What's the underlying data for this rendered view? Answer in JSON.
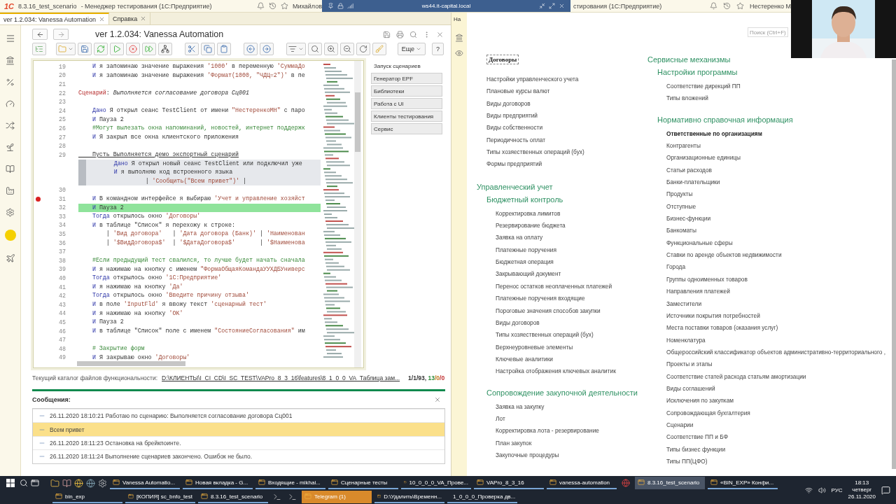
{
  "top_bar": {
    "logo": "1С",
    "app_title": "8.3.16_test_scenario",
    "subtitle": "- Менеджер тестирования (1С:Предприятие)",
    "user": "Михайлов",
    "remote_host": "ws44.it-capital.local",
    "right_title": "стирования (1С:Предприятие)",
    "right_user": "Нестеренко М"
  },
  "tabs": [
    {
      "label": "ver 1.2.034: Vanessa Automation",
      "selected": true
    },
    {
      "label": "Справка",
      "selected": false
    }
  ],
  "vanessa": {
    "title": "ver 1.2.034: Vanessa Automation",
    "more_button": "Еще",
    "help_button": "?",
    "code_lines": [
      {
        "number": "19",
        "kind": "code",
        "parts": [
          {
            "kind": "kw",
            "text": "    И"
          },
          {
            "kind": "txt",
            "text": " я запоминаю значение выражения "
          },
          {
            "kind": "str",
            "text": "'1000'"
          },
          {
            "kind": "txt",
            "text": " в переменную "
          },
          {
            "kind": "str",
            "text": "'СуммаДо"
          }
        ]
      },
      {
        "number": "20",
        "kind": "code",
        "parts": [
          {
            "kind": "kw",
            "text": "    И"
          },
          {
            "kind": "txt",
            "text": " я запоминаю значение выражения "
          },
          {
            "kind": "str",
            "text": "'Формат(1000, \"ЧДЦ=2\")'"
          },
          {
            "kind": "txt",
            "text": " в пе"
          }
        ]
      },
      {
        "number": "21",
        "kind": "code"
      },
      {
        "number": "22",
        "kind": "code",
        "parts": [
          {
            "kind": "head",
            "text": "Сценарий"
          },
          {
            "kind": "txt",
            "text": ":"
          },
          {
            "kind": "ital",
            "text": " Выполняется согласование договора Сц001"
          }
        ]
      },
      {
        "number": "23",
        "kind": "code"
      },
      {
        "number": "24",
        "kind": "code",
        "parts": [
          {
            "kind": "kw",
            "text": "    Дано"
          },
          {
            "kind": "txt",
            "text": " Я открыл сеанс TestClient от имени "
          },
          {
            "kind": "str",
            "text": "\"НестеренкоМН\""
          },
          {
            "kind": "txt",
            "text": " с паро"
          }
        ]
      },
      {
        "number": "25",
        "kind": "code",
        "parts": [
          {
            "kind": "kw",
            "text": "    И"
          },
          {
            "kind": "txt",
            "text": " Пауза 2"
          }
        ]
      },
      {
        "number": "26",
        "kind": "code",
        "parts": [
          {
            "kind": "cmt",
            "text": "    #Могут вылезать окна напоминаний, новостей, интернет поддержк"
          }
        ]
      },
      {
        "number": "27",
        "kind": "code",
        "parts": [
          {
            "kind": "kw",
            "text": "    И"
          },
          {
            "kind": "txt",
            "text": " Я закрыл все окна клиентского приложения"
          }
        ]
      },
      {
        "number": "28",
        "kind": "code"
      },
      {
        "number": "29",
        "kind": "code",
        "parts": [
          {
            "kind": "link",
            "text": "    Пусть Выполняется демо экспортный сценарий"
          }
        ]
      },
      {
        "kind": "inline",
        "parts": [
          {
            "kind": "kw",
            "text": "        Дано"
          },
          {
            "kind": "txt",
            "text": " Я открыл новый сеанс TestClient или подключил уже"
          }
        ]
      },
      {
        "kind": "inline",
        "parts": [
          {
            "kind": "kw",
            "text": "        И"
          },
          {
            "kind": "txt",
            "text": " я выполняю код встроенного языка"
          }
        ]
      },
      {
        "kind": "inline",
        "parts": [
          {
            "kind": "txt",
            "text": "                 | "
          },
          {
            "kind": "str",
            "text": "'Сообщить(\"Всем привет\")'"
          },
          {
            "kind": "txt",
            "text": " |"
          }
        ]
      },
      {
        "number": "30",
        "kind": "code"
      },
      {
        "number": "31",
        "kind": "breakpoint",
        "parts": [
          {
            "kind": "kw",
            "text": "    И"
          },
          {
            "kind": "txt",
            "text": " В командном интерфейсе я выбираю "
          },
          {
            "kind": "str",
            "text": "'Учет и управление хозяйст"
          }
        ]
      },
      {
        "number": "32",
        "kind": "current",
        "parts": [
          {
            "kind": "kw",
            "text": "    И"
          },
          {
            "kind": "txt",
            "text": " Пауза 2"
          }
        ]
      },
      {
        "number": "33",
        "kind": "code",
        "parts": [
          {
            "kind": "kw",
            "text": "    Тогда"
          },
          {
            "kind": "txt",
            "text": " открылось окно "
          },
          {
            "kind": "str",
            "text": "'Договоры'"
          }
        ]
      },
      {
        "number": "34",
        "kind": "code",
        "parts": [
          {
            "kind": "kw",
            "text": "    И"
          },
          {
            "kind": "txt",
            "text": " в таблице \"Список\" я перехожу к строке:"
          }
        ]
      },
      {
        "number": "35",
        "kind": "code",
        "parts": [
          {
            "kind": "txt",
            "text": "        | "
          },
          {
            "kind": "str",
            "text": "'Вид договора'"
          },
          {
            "kind": "txt",
            "text": "   | "
          },
          {
            "kind": "str",
            "text": "'Дата договора (Банк)'"
          },
          {
            "kind": "txt",
            "text": " | "
          },
          {
            "kind": "str",
            "text": "'Наименован"
          }
        ]
      },
      {
        "number": "36",
        "kind": "code",
        "parts": [
          {
            "kind": "txt",
            "text": "        | "
          },
          {
            "kind": "str",
            "text": "'$ВидДоговора$'"
          },
          {
            "kind": "txt",
            "text": "  | "
          },
          {
            "kind": "str",
            "text": "'$ДатаДоговора$'"
          },
          {
            "kind": "txt",
            "text": "       | "
          },
          {
            "kind": "str",
            "text": "'$Наименова"
          }
        ]
      },
      {
        "number": "37",
        "kind": "code"
      },
      {
        "number": "38",
        "kind": "code",
        "parts": [
          {
            "kind": "cmt",
            "text": "    #Если предыдущий тест свалился, то лучше будет начать сначала"
          }
        ]
      },
      {
        "number": "39",
        "kind": "code",
        "parts": [
          {
            "kind": "kw",
            "text": "    И"
          },
          {
            "kind": "txt",
            "text": " я нажимаю на кнопку с именем "
          },
          {
            "kind": "str",
            "text": "\"ФормаОбщаяКомандаУУХДБУниверс"
          }
        ]
      },
      {
        "number": "40",
        "kind": "code",
        "parts": [
          {
            "kind": "kw",
            "text": "    Тогда"
          },
          {
            "kind": "txt",
            "text": " открылось окно "
          },
          {
            "kind": "str",
            "text": "'1С:Предприятие'"
          }
        ]
      },
      {
        "number": "41",
        "kind": "code",
        "parts": [
          {
            "kind": "kw",
            "text": "    И"
          },
          {
            "kind": "txt",
            "text": " я нажимаю на кнопку "
          },
          {
            "kind": "str",
            "text": "'Да'"
          }
        ]
      },
      {
        "number": "42",
        "kind": "code",
        "parts": [
          {
            "kind": "kw",
            "text": "    Тогда"
          },
          {
            "kind": "txt",
            "text": " открылось окно "
          },
          {
            "kind": "str",
            "text": "'Введите причину отзыва'"
          }
        ]
      },
      {
        "number": "43",
        "kind": "code",
        "parts": [
          {
            "kind": "kw",
            "text": "    И"
          },
          {
            "kind": "txt",
            "text": " в поле "
          },
          {
            "kind": "str",
            "text": "'InputFld'"
          },
          {
            "kind": "txt",
            "text": " я ввожу текст "
          },
          {
            "kind": "str",
            "text": "'сценарный тест'"
          }
        ]
      },
      {
        "number": "44",
        "kind": "code",
        "parts": [
          {
            "kind": "kw",
            "text": "    И"
          },
          {
            "kind": "txt",
            "text": " я нажимаю на кнопку "
          },
          {
            "kind": "str",
            "text": "'OK'"
          }
        ]
      },
      {
        "number": "45",
        "kind": "code",
        "parts": [
          {
            "kind": "kw",
            "text": "    И"
          },
          {
            "kind": "txt",
            "text": " Пауза 2"
          }
        ]
      },
      {
        "number": "46",
        "kind": "code",
        "parts": [
          {
            "kind": "kw",
            "text": "    И"
          },
          {
            "kind": "txt",
            "text": " в таблице \"Список\" поле с именем "
          },
          {
            "kind": "str",
            "text": "\"СостояниеСогласования\""
          },
          {
            "kind": "txt",
            "text": " им"
          }
        ]
      },
      {
        "number": "47",
        "kind": "code"
      },
      {
        "number": "48",
        "kind": "code",
        "parts": [
          {
            "kind": "cmt",
            "text": "    # Закрытие форм"
          }
        ]
      },
      {
        "number": "49",
        "kind": "code",
        "parts": [
          {
            "kind": "kw",
            "text": "    И"
          },
          {
            "kind": "txt",
            "text": " Я закрываю окно "
          },
          {
            "kind": "str",
            "text": "'Договоры'"
          }
        ]
      }
    ],
    "side_buttons": [
      {
        "label": "Запуск сценариев",
        "kind": "plain"
      },
      {
        "label": "Генератор EPF",
        "kind": "button"
      },
      {
        "label": "Библиотеки",
        "kind": "button"
      },
      {
        "label": "Работа с UI",
        "kind": "button"
      },
      {
        "label": "Клиенты тестирования",
        "kind": "button"
      },
      {
        "label": "Сервис",
        "kind": "button"
      }
    ],
    "status": {
      "label": "Текущий каталог файлов функциональности:",
      "path": "D:\\КЛИЕНТЫ\\I_CI_CD\\I_SC_TEST\\VAPro_8_3_16\\features\\8_1_0_0_VA_Таблица зам...",
      "position": "1/1/93,",
      "counts": [
        {
          "text": "13",
          "color": "#2e8b3a"
        },
        {
          "text": "/0",
          "color": "#c07a20"
        },
        {
          "text": "/0",
          "color": "#c03030"
        }
      ]
    },
    "messages": {
      "title": "Сообщения:",
      "rows": [
        {
          "text": "26.11.2020 18:10:21 Работаю по сценарию: Выполняется согласование договора Сц001",
          "selected": false
        },
        {
          "text": "Всем привет",
          "selected": true
        },
        {
          "text": "26.11.2020 18:11:23 Остановка на брейкпоинте.",
          "selected": false
        },
        {
          "text": "26.11.2020 18:11:24 Выполнение сценариев закончено. Ошибок не было.",
          "selected": false
        }
      ]
    }
  },
  "right_window": {
    "tab": "На",
    "search": {
      "placeholder": "Поиск (Ctrl+F)"
    },
    "columns": [
      [
        {
          "title": "Договоры",
          "kind": "focused",
          "items": [
            "Настройки управленческого учета",
            "Плановые курсы валют",
            "Виды договоров",
            "Виды предприятий",
            "Виды собственности",
            "Периодичность оплат",
            "Типы хозяественных операций (бух)",
            "Формы предприятий"
          ]
        },
        {
          "title": "Управленческий учет",
          "kind": "section",
          "children": [
            {
              "title": "Бюджетный контроль",
              "kind": "subsection",
              "items": [
                "Корректировка лимитов",
                "Резервирование бюджета",
                "Заявка на оплату",
                "Платежные поручения",
                "Бюджетная операция",
                "Закрывающий документ",
                "Перенос остатков неоплаченных платежей",
                "Платежные поручения входящие",
                "Пороговые значения способов закупки",
                "Виды договоров",
                "Типы хозяественных операций (бух)",
                "Верхнеуровневые элементы",
                "Ключевые аналитики",
                "Настройка отображения ключевых аналитик"
              ]
            },
            {
              "title": "Сопровождение закупочной деятельности",
              "kind": "subsection",
              "items": [
                "Заявка на закупку",
                "Лот",
                "Корректировка лота - резервирование",
                "План закупок",
                "Закупочные процедуры"
              ]
            }
          ]
        }
      ],
      [
        {
          "title": "Сервисные механизмы",
          "kind": "section",
          "children": [
            {
              "title": "Настройки программы",
              "kind": "subsection",
              "items": [
                "Соответствие дирекций ПП",
                "Типы вложений"
              ]
            },
            {
              "title": "Нормативно справочная информация",
              "kind": "subsection",
              "items": [
                {
                  "text": "Ответственные по организациям",
                  "bold": true
                },
                {
                  "text": "Контрагенты",
                  "bold": false
                },
                {
                  "text": "Организационные единицы",
                  "bold": false
                },
                {
                  "text": "Статьи расходов",
                  "bold": false
                },
                {
                  "text": "Банки-плательщики",
                  "bold": false
                },
                {
                  "text": "Продукты",
                  "bold": false
                },
                {
                  "text": "Отступные",
                  "bold": false
                },
                {
                  "text": "Бизнес-функции",
                  "bold": false
                },
                {
                  "text": "Банкоматы",
                  "bold": false
                },
                {
                  "text": "Функциональные сферы",
                  "bold": false
                },
                {
                  "text": "Ставки по аренде объектов недвижимости",
                  "bold": false
                },
                {
                  "text": "Города",
                  "bold": false
                },
                {
                  "text": "Группы одноименных товаров",
                  "bold": false
                },
                {
                  "text": "Направления платежей",
                  "bold": false
                },
                {
                  "text": "Заместители",
                  "bold": false
                },
                {
                  "text": "Источники покрытия потребностей",
                  "bold": false
                },
                {
                  "text": "Места поставки товаров (оказания услуг)",
                  "bold": false
                },
                {
                  "text": "Номенклатура",
                  "bold": false
                },
                {
                  "text": "Общероссийский классификатор объектов административно-территориального ,",
                  "bold": false
                },
                {
                  "text": "Проекты и этапы",
                  "bold": false
                },
                {
                  "text": "Соответствие статей расхода статьям амортизации",
                  "bold": false
                },
                {
                  "text": "Виды соглашений",
                  "bold": false
                },
                {
                  "text": "Исключения по закупкам",
                  "bold": false
                },
                {
                  "text": "Сопровождающая бухгалтерия",
                  "bold": false
                },
                {
                  "text": "Сценарии",
                  "bold": false
                },
                {
                  "text": "Соответствие ПП и БФ",
                  "bold": false
                },
                {
                  "text": "Типы бизнес функции",
                  "bold": false
                },
                {
                  "text": "Типы ПП(ЦФО)",
                  "bold": false
                }
              ]
            }
          ]
        }
      ]
    ]
  },
  "taskbar": {
    "upper_windows": [
      {
        "label": "Vanessa Automatio...",
        "kind": "normal"
      },
      {
        "label": "Новая вкладка - G...",
        "kind": "normal"
      },
      {
        "label": "Входящие - mikhai...",
        "kind": "normal"
      },
      {
        "label": "Сценарные тесты",
        "kind": "normal"
      },
      {
        "label": "10_0_0_0_VA_Прове...",
        "kind": "normal"
      },
      {
        "label": "VAPro_8_3_16",
        "kind": "normal"
      },
      {
        "label": "vanessa-automation",
        "kind": "normal"
      },
      {
        "kind": "icon"
      },
      {
        "label": "8.3.16_test_scenario",
        "kind": "active"
      },
      {
        "label": "«BIN_EXP» Конфи...",
        "kind": "normal"
      }
    ],
    "lower_windows": [
      {
        "label": "bin_exp",
        "kind": "normal"
      },
      {
        "label": "[КОПИЯ] sc_bnfo_test",
        "kind": "normal"
      },
      {
        "label": "8.3.16_test_scenario",
        "kind": "normal"
      },
      {
        "kind": "icon"
      },
      {
        "kind": "icon"
      },
      {
        "label": "Telegram (1)",
        "kind": "flashing"
      },
      {
        "label": "D:\\Удалить\\Временн...",
        "kind": "normal"
      },
      {
        "label": "1_0_0_0_Проверка дв...",
        "kind": "normal"
      }
    ],
    "language": "РУС",
    "time": "18:13",
    "weekday": "четверг",
    "date": "26.11.2020"
  }
}
